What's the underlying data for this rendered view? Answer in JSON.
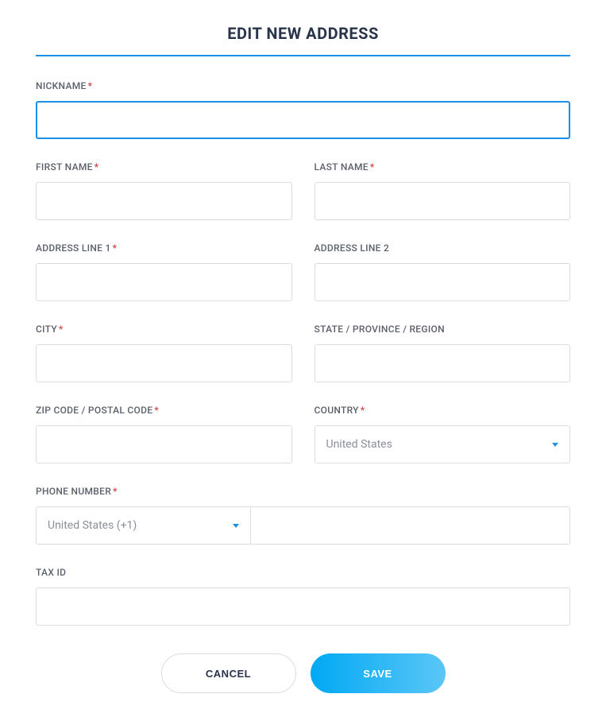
{
  "title": "EDIT NEW ADDRESS",
  "fields": {
    "nickname": {
      "label": "NICKNAME",
      "required": true,
      "value": ""
    },
    "first_name": {
      "label": "FIRST NAME",
      "required": true,
      "value": ""
    },
    "last_name": {
      "label": "LAST NAME",
      "required": true,
      "value": ""
    },
    "address1": {
      "label": "ADDRESS LINE 1",
      "required": true,
      "value": ""
    },
    "address2": {
      "label": "ADDRESS LINE 2",
      "required": false,
      "value": ""
    },
    "city": {
      "label": "CITY",
      "required": true,
      "value": ""
    },
    "state": {
      "label": "STATE / PROVINCE / REGION",
      "required": false,
      "value": ""
    },
    "zip": {
      "label": "ZIP CODE / POSTAL CODE",
      "required": true,
      "value": ""
    },
    "country": {
      "label": "COUNTRY",
      "required": true,
      "selected": "United States"
    },
    "phone": {
      "label": "PHONE NUMBER",
      "required": true,
      "code_selected": "United States (+1)",
      "value": ""
    },
    "tax_id": {
      "label": "TAX ID",
      "required": false,
      "value": ""
    }
  },
  "required_marker": "*",
  "buttons": {
    "cancel": "CANCEL",
    "save": "SAVE"
  }
}
